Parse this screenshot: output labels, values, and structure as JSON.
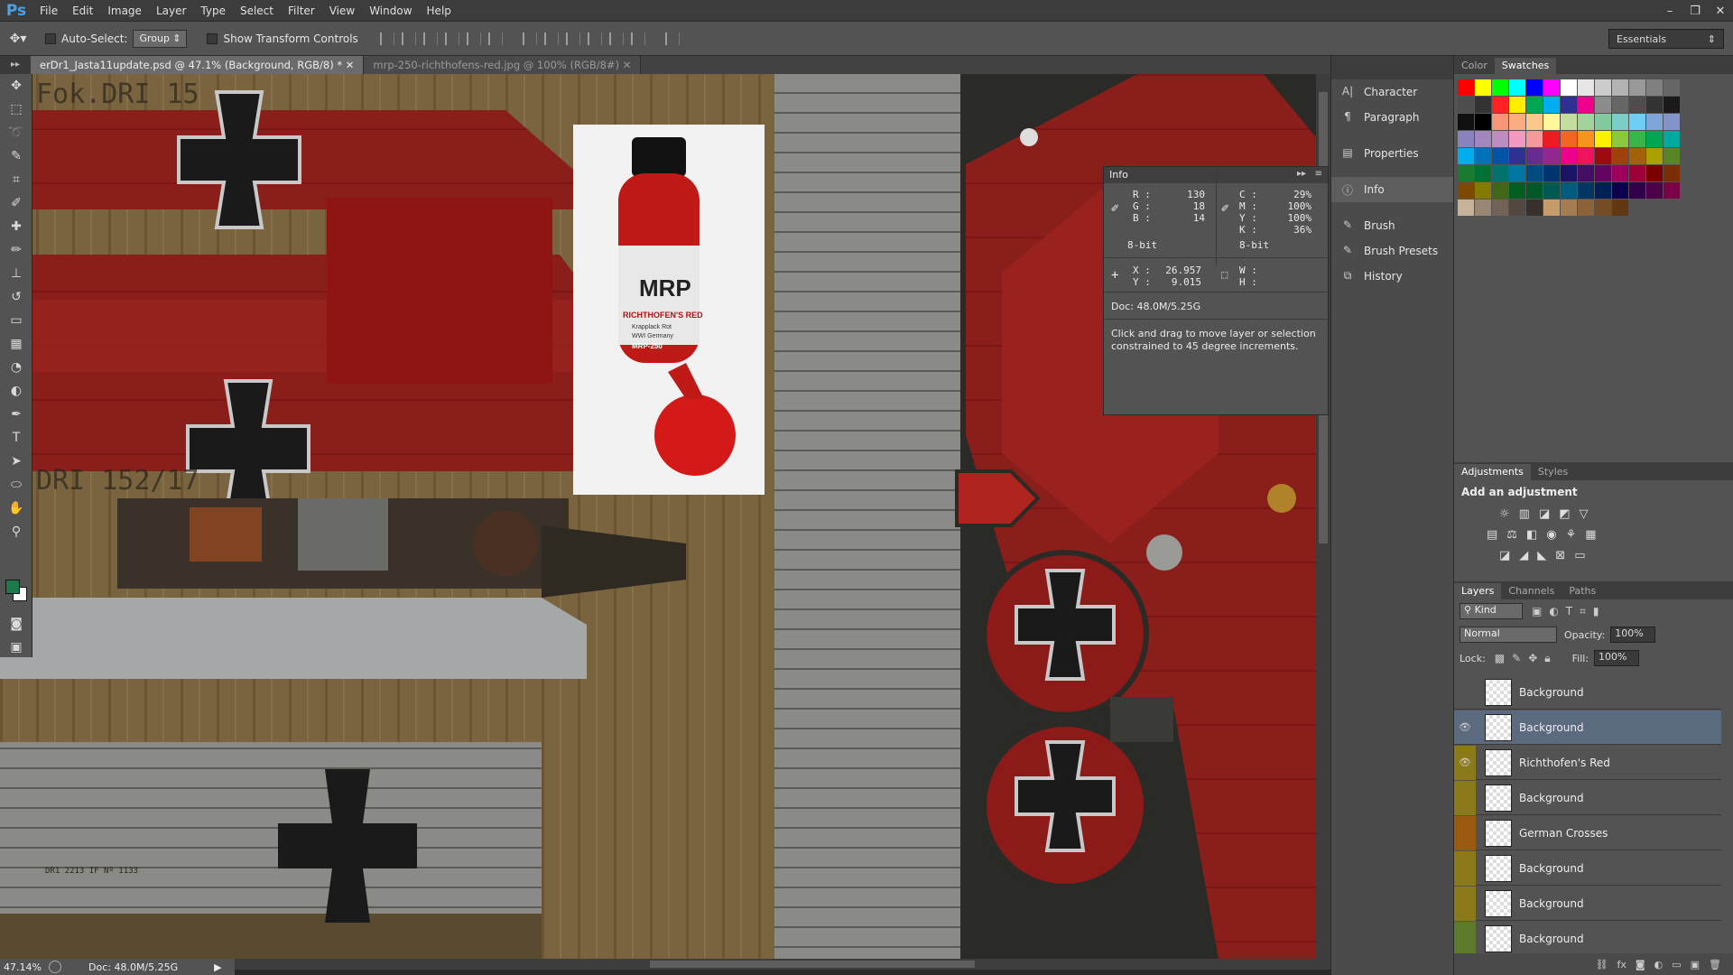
{
  "app": {
    "logo": "Ps"
  },
  "menu": [
    "File",
    "Edit",
    "Image",
    "Layer",
    "Type",
    "Select",
    "Filter",
    "View",
    "Window",
    "Help"
  ],
  "window_controls": [
    "–",
    "❐",
    "✕"
  ],
  "options": {
    "auto_select_label": "Auto-Select:",
    "auto_select_value": "Group",
    "transform_label": "Show Transform Controls",
    "workspace": "Essentials"
  },
  "tabs": [
    {
      "label": "erDr1_Jasta11update.psd @ 47.1% (Background, RGB/8) * ✕",
      "active": true
    },
    {
      "label": "mrp-250-richthofens-red.jpg @ 100% (RGB/8#) ✕",
      "active": false
    }
  ],
  "status": {
    "zoom": "47.14%",
    "doc": "Doc: 48.0M/5.25G"
  },
  "canvas_text": {
    "fok_label": "Fok.DRI 15",
    "dri_label": "DRI 152/17",
    "small_label": "DR1 2213   IF Nº 1133"
  },
  "bottle": {
    "brand": "MRP",
    "name": "RICHTHOFEN'S RED",
    "sub1": "Krapplack Rot",
    "sub2": "WWI Germany",
    "code": "MRP-250"
  },
  "dock": {
    "items": [
      {
        "icon": "character-icon",
        "glyph": "A|",
        "label": "Character"
      },
      {
        "icon": "paragraph-icon",
        "glyph": "¶",
        "label": "Paragraph"
      },
      {
        "icon": "properties-icon",
        "glyph": "▤",
        "label": "Properties"
      },
      {
        "icon": "info-icon",
        "glyph": "ⓘ",
        "label": "Info"
      },
      {
        "icon": "brush-icon",
        "glyph": "✎",
        "label": "Brush"
      },
      {
        "icon": "brush-presets-icon",
        "glyph": "✎",
        "label": "Brush Presets"
      },
      {
        "icon": "history-icon",
        "glyph": "⧉",
        "label": "History"
      }
    ]
  },
  "info": {
    "title": "Info",
    "rgb": {
      "R": "130",
      "G": "18",
      "B": "14",
      "bit": "8-bit"
    },
    "cmyk": {
      "C": "29%",
      "M": "100%",
      "Y": "100%",
      "K": "36%",
      "bit": "8-bit"
    },
    "xy": {
      "X": "26.957",
      "Y": "9.015"
    },
    "wh": {
      "W": "",
      "H": ""
    },
    "doc": "Doc: 48.0M/5.25G",
    "hint": "Click and drag to move layer or selection constrained to 45 degree increments."
  },
  "panels": {
    "color_tabs": [
      "Color",
      "Swatches"
    ],
    "adj_tabs": [
      "Adjustments",
      "Styles"
    ],
    "adj_title": "Add an adjustment",
    "layer_tabs": [
      "Layers",
      "Channels",
      "Paths"
    ],
    "kind": "Kind",
    "blend": "Normal",
    "opacity_label": "Opacity:",
    "opacity": "100%",
    "lock_label": "Lock:",
    "fill_label": "Fill:",
    "fill": "100%"
  },
  "layers": [
    {
      "name": "Background",
      "visible": false,
      "color": "",
      "selected": false
    },
    {
      "name": "Background",
      "visible": true,
      "color": "",
      "selected": true
    },
    {
      "name": "Richthofen's Red",
      "visible": true,
      "color": "#8a7a1a",
      "selected": false
    },
    {
      "name": "Background",
      "visible": false,
      "color": "#8a7a1a",
      "selected": false
    },
    {
      "name": "German Crosses",
      "visible": false,
      "color": "#9a5a10",
      "selected": false
    },
    {
      "name": "Background",
      "visible": false,
      "color": "#8a7a1a",
      "selected": false
    },
    {
      "name": "Background",
      "visible": false,
      "color": "#8a7a1a",
      "selected": false
    },
    {
      "name": "Background",
      "visible": false,
      "color": "#5c7a2a",
      "selected": false
    }
  ],
  "colors": {
    "accent_red": "#821210",
    "fg": "#1c7a4a"
  }
}
